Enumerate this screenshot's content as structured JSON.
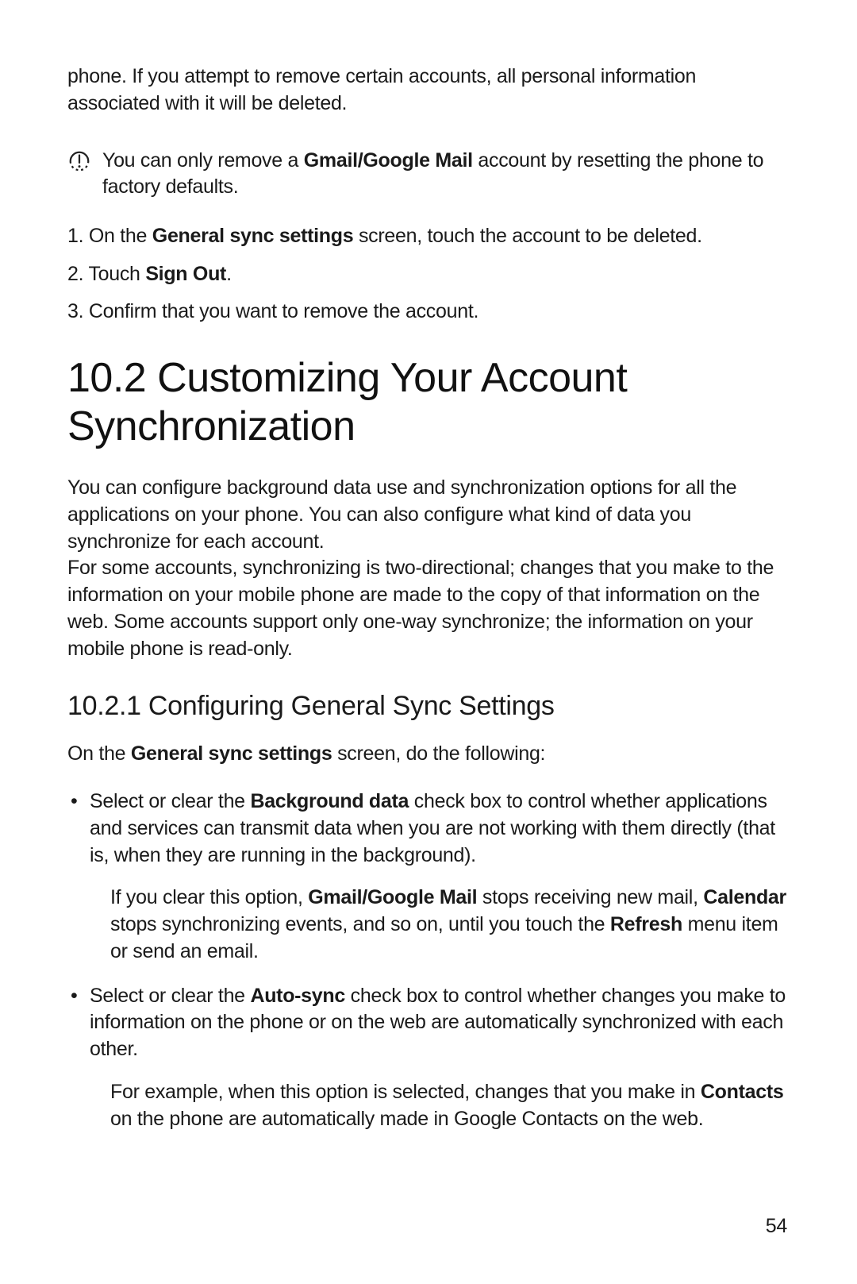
{
  "intro": "phone. If you attempt to remove certain accounts, all  personal information associated with it will be deleted.",
  "note": {
    "pre": "You can only remove a ",
    "bold": "Gmail/Google Mail",
    "post": " account by resetting the phone to factory defaults."
  },
  "steps": {
    "s1": {
      "pre": "1. On the ",
      "bold": "General sync settings",
      "post": " screen, touch the account to be deleted."
    },
    "s2": {
      "pre": "2. Touch ",
      "bold": "Sign Out",
      "post": "."
    },
    "s3": {
      "text": "3. Confirm that you want to remove the account."
    }
  },
  "heading": "10.2  Customizing Your Account Synchronization",
  "para1": "You can configure background data use and synchronization options for all the applications on your phone. You can also configure what kind of data you synchronize for each account.",
  "para2": "For some accounts, synchronizing is two-directional; changes that you make to the information on your mobile phone are made to the copy of that information on the web. Some accounts support only one-way synchronize; the information on your mobile phone is read-only.",
  "subheading": "10.2.1  Configuring General Sync Settings",
  "leadin": {
    "pre": "On the ",
    "bold": "General sync settings",
    "post": " screen, do the following:"
  },
  "bullets": {
    "b1": {
      "pre": "Select or clear the ",
      "bold": "Background data",
      "post": " check box to control whether applications and services can transmit data when you are not working with them directly (that is, when they are running in the background).",
      "inner": {
        "t1": "If you clear this option, ",
        "b1": "Gmail/Google Mail",
        "t2": " stops receiving new mail, ",
        "b2": "Calendar",
        "t3": " stops synchronizing events, and so on, until you touch the ",
        "b3": "Refresh",
        "t4": " menu item or send an email."
      }
    },
    "b2": {
      "pre": "Select or clear the ",
      "bold": "Auto-sync",
      "post": " check box to control whether changes you make to information on the phone or on the web are automatically synchronized with each other.",
      "inner": {
        "t1": "For example, when this option is selected, changes that you make in ",
        "b1": "Contacts",
        "t2": " on the phone are automatically made in Google Contacts on the web."
      }
    }
  },
  "pageNumber": "54"
}
